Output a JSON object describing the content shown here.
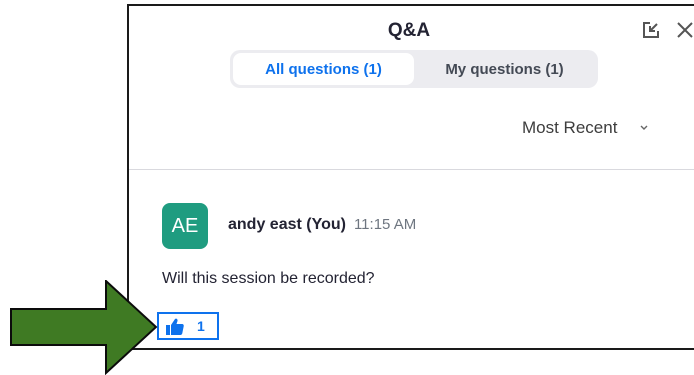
{
  "header": {
    "title": "Q&A",
    "popout_icon": "popout-icon",
    "close_icon": "close-icon"
  },
  "tabs": [
    {
      "label": "All questions (1)",
      "active": true
    },
    {
      "label": "My questions (1)",
      "active": false
    }
  ],
  "sort": {
    "selected": "Most Recent"
  },
  "question": {
    "avatar_initials": "AE",
    "author": "andy east (You)",
    "time": "11:15 AM",
    "text": "Will this session be recorded?",
    "like_count": "1"
  },
  "colors": {
    "accent": "#0e72ed",
    "avatar": "#1f9c80",
    "annotation_arrow": "#3f7a23"
  }
}
